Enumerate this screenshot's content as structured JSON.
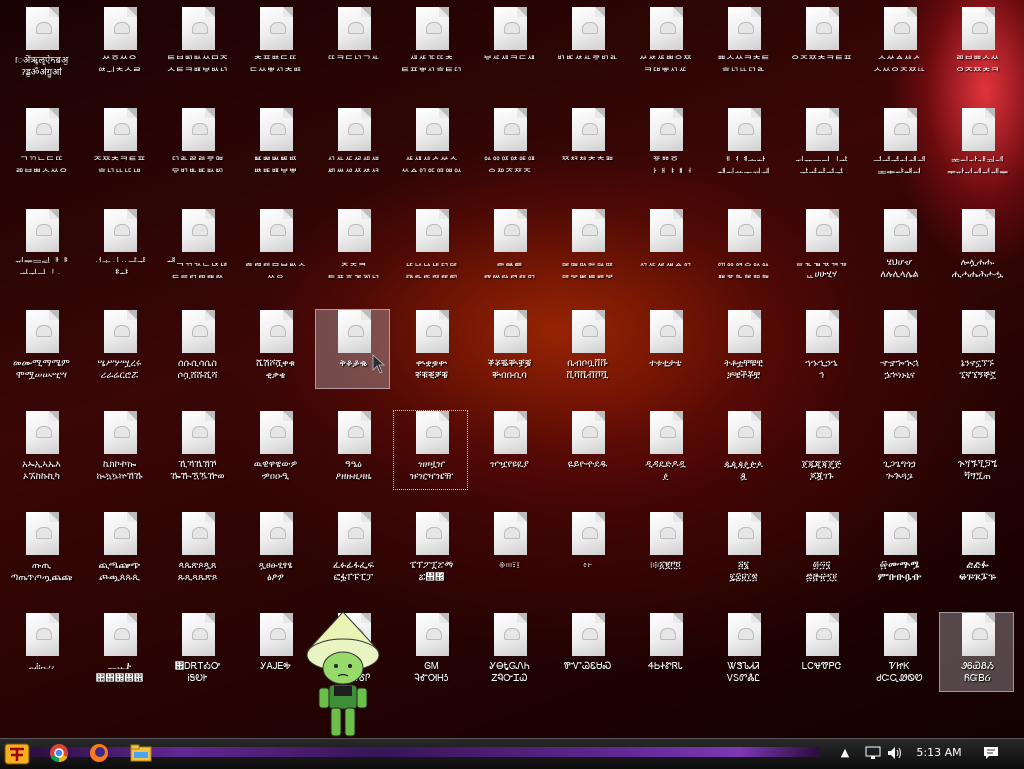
{
  "desktop": {
    "icon_rows": [
      [
        "ॎऄ॑ॠॡऐॸॿॶ\nॽॾॖॐॳॻॗॴ",
        "ᄽᅙᄊᄋ\nᅉᅠᅱᅕᄉᄅ",
        "ᄐᄇᄢᄡᄊᄆᄌ\nᄉᄐᄏᄪᄫᄡᄓ",
        "ᄎᄑᄨᄃᄄ\nᄃᄊᄬᄭᄎᄧ",
        "ᄄᄏᄃᄓᄀᄮ",
        "ᄺᄹᄀᄃᄄᄎ\nᄐᄑᄬᄭᄒᄐᄗ",
        "ᄫᄯᄺᄏᄃᄺ",
        "ᄞᄠᄷᄮᄛᄞᄘ",
        "ᄽᄷᄹᄈᄋᄍ\nᄏᄃᄇᄬᄭᄯ",
        "ᄈᄉᄊᄏᄎᄐ\nᄒᄓᄔᄗᄘ",
        "ᄋᄌᄍᄎᄏᄐᄑ",
        "ᄉᄽᅀᄻᄼ\nᄉᄊᄋᄌᄍᄔ",
        "ᄅᄆᄇᄈᄉᄊ\nᄋᄌᄍᄎᄏ"
      ],
      [
        "ᄀᄁᄂᄃᄄ\nᄅᄆᄇᄈᄉᄊᄋ",
        "ᄌᄍᄎᄏᄐᄑ\nᄒᄓᄔᄕᄖ",
        "ᄗᄘᄙᄚᄛᄜ\nᄝᄞᄟᄠᄡᄢ",
        "ᄣᄤᄥᄦᄧ\nᄨᄩᄪᄫᄬ",
        "ᄭᄮᄯᄰᄱᄲ\nᄳᄴᄵᄶᄷᄸ",
        "ᄹᄺᄻᄼᄽᄾ\nᄿᅀᅁᅂᅃᅄᅅ",
        "ᅆᅇᅈᅉᅊᅋ\nᅌᅍᅎᅏᅐ",
        "ᅑᅒᅓᅔᅕᅖ",
        "ᅗᅘᅙ\nᅠᅡᅢᅣᅤᅥ",
        "ᅦᅧᅨᅩᅪ\nᅫᅬᅭᅮᅯᅰ",
        "ᅱᅲᅳᅴᅵᅶ\nᅷᅸᅹᅺᅻ",
        "ᅼᅽᅾᅿᆀᆁ\nᆂᆃᆄᆅᆆ",
        "ᆇᆈᆉᆊᆋᆌ\nᆍᆎᆏᆐᆑᆒᆓ"
      ],
      [
        "ᆔᆕᆖᆗᆘᆙ\nᆚᆛᆜᆝᆞ",
        "ᆟᆠᆡᆢᆣᆤ\nᆥᆦ",
        "ᆧᆨᆩᆪᆫᆬᆭ\nᆮᆯᆰᆱᆲᆳ",
        "ᆴᆵᆶᆷᆸᆹᆺ\nᆻᆼ",
        "ᆽᆾᆿ\nᇀᇁᇂᇃᇄᇅ",
        "ᇆᇇᇈᇉᇊᇋ\nᇌᇍᇎᇏᇐᇑ",
        "ᇒᇓᇔ\nᇕᇖᇗᇘᇙᇚ",
        "ᇛᇜᇝᇞᇟᇠ\nᇡᇢᇣᇤᇥᇦ",
        "ᇧᇨᇩᇪᇫᇬ",
        "ᇭᇮᇯᇰᇱᇲ\nᇳᇴᇵᇶᇷᇸ",
        "ᇹᇺᇻᇼᇽᇾ\nᇿሀሁሂሃ",
        "ሄህሆሇ\nለሉሊላሌል",
        "ሎሏሐሑ\nሒሓሔሕሖሗ"
      ],
      [
        "መሙሚማሜም\nሞሟሠሡሢሣ",
        "ሤሥሦሧረሩ\nሪራሬርሮሯ",
        "ሰሱሲሳሴስ\nሶሷሸሹሺሻ",
        "ሼሽሾሿቀቁ\nቂቃቄ",
        "ቅቆቇቈ",
        "ቊቋቌቍ\nቐቑቒቓቔ",
        "ቕቖቘቚቛቜ\nቝበቡቢባ",
        "ቤብቦቧቨቩ\nቪቫቬቭቮቯ",
        "ተቱቲታቴ",
        "ትቶቷቸቹቺ\nቻቼችቾቿ",
        "ኀኁኂኃኄ\nኅ",
        "ኆኇኈኊኋ\nኌኍነኑኒና",
        "ኔንኖኗኘኙ\nኚኛኜኝኞኟ"
      ],
      [
        "አኡኢኣኤእ\nኦኧከኩኪካ",
        "ኬክኮኯኰ\nኲኳኴኵኸኹ",
        "ኺኻኼኽኾ\nዀዂዃዄዅወ",
        "ዉዊዋዌውዎ\nዏዐዑዒ",
        "ዓዔዕ\nዖዘዙዚዛዜ",
        "ዝዞዟዠ\nዡዢዣዤዥ",
        "ዦዧየዩዪያ",
        "ዬይዮዯደዱ",
        "ዲዳዴድዶዷ\nዸ",
        "ዹዺዻዼዽዾ\nዿ",
        "ጀጁጂጃጄጅ\nጆጇገጉ",
        "ጊጋጌግጎጏ\nጐጒጓጔ",
        "ጕጘጙጚጛጜ\nጝጞጟጠ"
      ],
      [
        "ጡጢ\nጣጤጥጦጧጨጩ",
        "ጪጫጬጭ\nጮጯጰጱጲ",
        "ጳጴጵጶጷጸ\nጹጺጻጼጽጾ",
        "ጿፀፁፂፃፄ\nፅፆፇ",
        "ፈፉፊፋፌፍ\nፎፏፐፑፒፓ",
        "ፔፕፖፗፘፙ\nፚ፛፜፝፞፟",
        "፠፡።፣፤",
        "፥፦",
        "፧፨፩፪፫፬",
        "፭፮\n፯፰፱፲፳",
        "፴፵፶\n፷፸፹፺፻",
        "፼ᎀᎁᎂ\nᎃᎄᎅᎆᎇ",
        "ᎈᎉᎊ\nᎋᎌᎍᎎᎏ"
      ],
      [
        "᎐᎑᎒᎓᎔᎕᎖",
        "᎗᎘᎙\n᎚᎛᎜᎝᎞",
        "᎟ᎠᎡᎢᎣᎤ\nᎥᎦᎧᎨ",
        "ᎩᎪᎫᎬᎭ",
        "ᎮᎯᎰ\nᎱᎲᎳᎴᎵ",
        "ᎶᎷ\nᎸᎹᎺᎻᎼ",
        "ᎽᎾᎿᏀᏁᏂ\nᏃᏄᏅᏆᏇ",
        "ᏈᏉᏊᏋᏌᏍ",
        "ᏎᏏᏐᏑᏒᏓ",
        "ᏔᏕᏖᏗᏘ\nᏙᏚᏛᏜᏝ",
        "ᏞᏟᏠᏡᏢᏣ",
        "ᏤᏥᏦ\nᏧᏨᏩᏪᏫᏬ",
        "ᏭᏮᏯᏰᏱ\nᏲᏳᏴᏵ"
      ]
    ]
  },
  "taskbar": {
    "pinned": [
      {
        "name": "chrome-icon",
        "color": "#e64a3b"
      },
      {
        "name": "firefox-icon",
        "color": "#ff7a1a"
      },
      {
        "name": "explorer-icon",
        "color": "#f5c242"
      }
    ],
    "clock": "5:13 AM",
    "accent": "#6d2aa8"
  }
}
